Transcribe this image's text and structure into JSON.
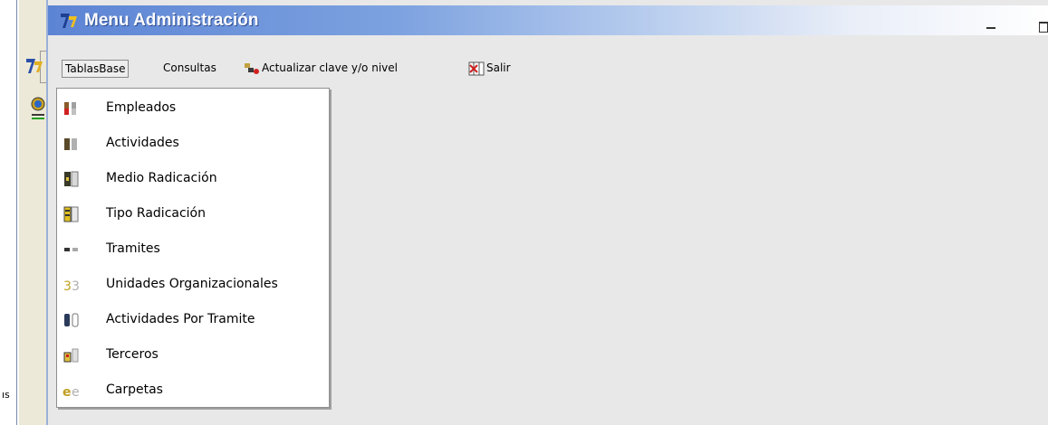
{
  "window": {
    "title": "Menu Administración"
  },
  "menubar": {
    "tablas_base": "TablasBase",
    "consultas": "Consultas",
    "actualizar": "Actualizar clave y/o nivel",
    "salir": "Salir"
  },
  "dropdown": {
    "items": [
      {
        "label": "Empleados",
        "icon": "employees-icon"
      },
      {
        "label": "Actividades",
        "icon": "activities-icon"
      },
      {
        "label": "Medio Radicación",
        "icon": "filing-medium-icon"
      },
      {
        "label": "Tipo Radicación",
        "icon": "filing-type-icon"
      },
      {
        "label": "Tramites",
        "icon": "procedures-icon"
      },
      {
        "label": "Unidades Organizacionales",
        "icon": "org-units-icon"
      },
      {
        "label": "Actividades Por Tramite",
        "icon": "activities-per-procedure-icon"
      },
      {
        "label": "Terceros",
        "icon": "third-parties-icon"
      },
      {
        "label": "Carpetas",
        "icon": "folders-icon"
      }
    ]
  },
  "background": {
    "left_text": "ıs"
  },
  "colors": {
    "titlebar_start": "#5c84d4",
    "titlebar_end": "#ffffff",
    "menu_bg": "#e8e8e8"
  }
}
